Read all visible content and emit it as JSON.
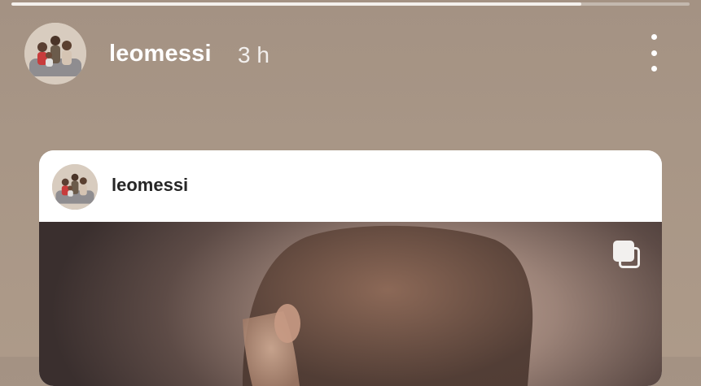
{
  "story": {
    "progress": 0.84,
    "username": "leomessi",
    "time": "3 h",
    "avatar_icon": "profile-photo"
  },
  "post": {
    "username": "leomessi",
    "avatar_icon": "profile-photo",
    "multiple_images_icon": "carousel-icon"
  },
  "colors": {
    "background": "#a89686",
    "card": "#ffffff",
    "text_dark": "#262626",
    "text_light": "#ffffff"
  }
}
